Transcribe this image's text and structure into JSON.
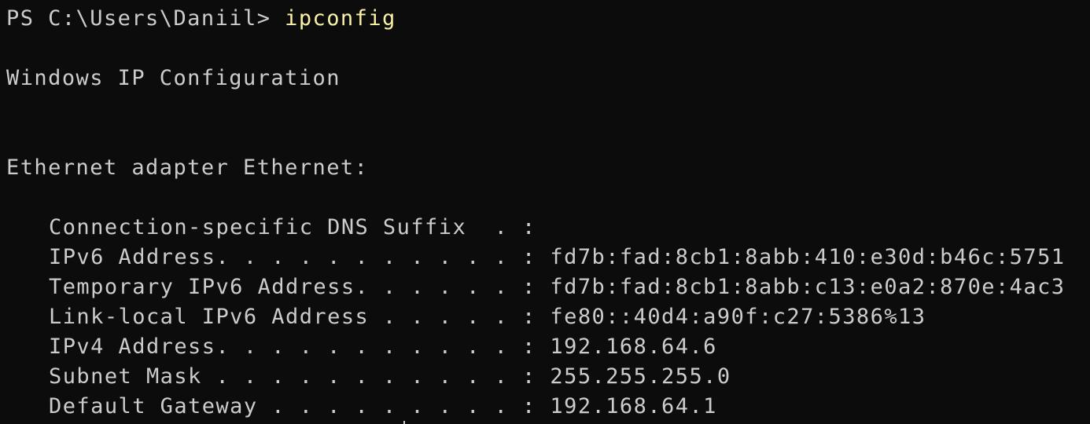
{
  "prompt": {
    "path": "PS C:\\Users\\Daniil> ",
    "command": "ipconfig"
  },
  "header": "Windows IP Configuration",
  "adapter_title": "Ethernet adapter Ethernet:",
  "entries": [
    {
      "label": "Connection-specific DNS Suffix  . :",
      "value": ""
    },
    {
      "label": "IPv6 Address. . . . . . . . . . . :",
      "value": " fd7b:fad:8cb1:8abb:410:e30d:b46c:5751"
    },
    {
      "label": "Temporary IPv6 Address. . . . . . :",
      "value": " fd7b:fad:8cb1:8abb:c13:e0a2:870e:4ac3"
    },
    {
      "label": "Link-local IPv6 Address . . . . . :",
      "value": " fe80::40d4:a90f:c27:5386%13"
    },
    {
      "label": "IPv4 Address. . . . . . . . . . . :",
      "value": " 192.168.64.6"
    },
    {
      "label": "Subnet Mask . . . . . . . . . . . :",
      "value": " 255.255.255.0"
    },
    {
      "label": "Default Gateway . . . . . . . . . :",
      "value": " 192.168.64.1"
    }
  ],
  "colors": {
    "background": "#0c0c0c",
    "text": "#cccccc",
    "command": "#f9f1a5"
  }
}
